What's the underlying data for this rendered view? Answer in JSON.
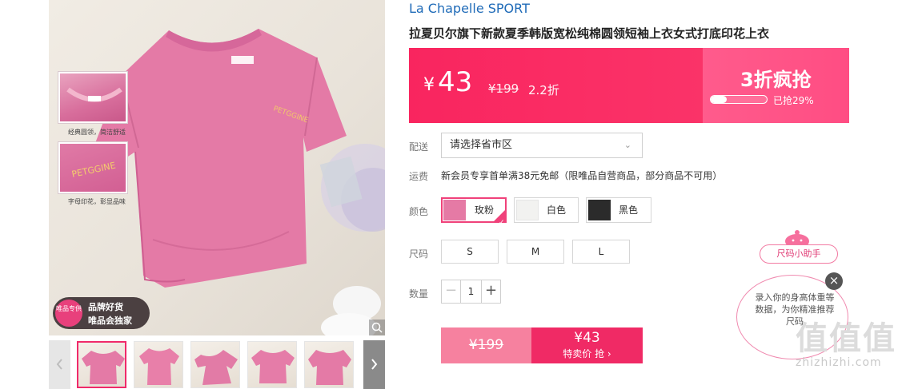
{
  "gallery": {
    "detail_captions": [
      "经典圆领，简洁舒适",
      "字母印花，彰显品味"
    ],
    "badge": {
      "circle": "唯品专供",
      "line1": "品牌好货",
      "line2": "唯品会独家"
    },
    "thumbnail_count": 6
  },
  "product": {
    "brand": "La Chapelle SPORT",
    "title": "拉夏贝尔旗下新款夏季韩版宽松纯棉圆领短袖上衣女式打底印花上衣"
  },
  "price": {
    "currency": "¥",
    "current": "43",
    "original": "¥199",
    "discount": "2.2折",
    "flash_sale_label": "3折疯抢",
    "sold_percent": 29,
    "sold_text": "已抢29%"
  },
  "delivery": {
    "label": "配送",
    "select_value": "请选择省市区"
  },
  "shipping": {
    "label": "运费",
    "text": "新会员专享首单满38元免邮（限唯品自营商品，部分商品不可用）"
  },
  "colors": {
    "label": "颜色",
    "options": [
      {
        "name": "玫粉",
        "selected": true,
        "swatch": "#e57aa5"
      },
      {
        "name": "白色",
        "selected": false,
        "swatch": "#f2f2f0"
      },
      {
        "name": "黑色",
        "selected": false,
        "swatch": "#2b2b2b"
      }
    ]
  },
  "sizes": {
    "label": "尺码",
    "options": [
      "S",
      "M",
      "L"
    ]
  },
  "quantity": {
    "label": "数量",
    "minus": "−",
    "value": "1",
    "plus": "+"
  },
  "buy": {
    "original": "¥199",
    "price": "¥43",
    "action": "特卖价 抢 ›"
  },
  "helper": {
    "tag": "尺码小助手",
    "text": "录入你的身高体重等数据，为你精准推荐尺码",
    "close": "×"
  },
  "watermark": {
    "glyphs": "值值值",
    "text": "zhizhizhi.com"
  },
  "theme": {
    "accent": "#f9255f",
    "link": "#1f6bb8",
    "product_pink": "#e47aa6"
  }
}
